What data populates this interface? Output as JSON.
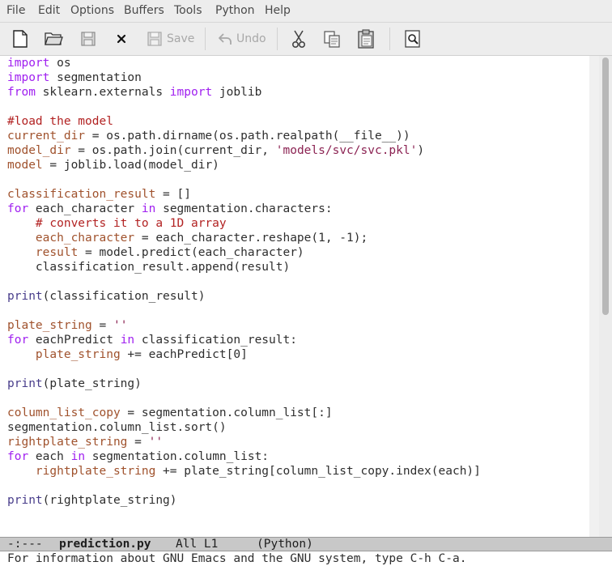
{
  "menu": [
    "File",
    "Edit",
    "Options",
    "Buffers",
    "Tools",
    "Python",
    "Help"
  ],
  "toolbar": {
    "save_label": "Save",
    "undo_label": "Undo"
  },
  "code": [
    [
      {
        "t": "import",
        "c": "kw"
      },
      {
        "t": " os"
      }
    ],
    [
      {
        "t": "import",
        "c": "kw"
      },
      {
        "t": " segmentation"
      }
    ],
    [
      {
        "t": "from",
        "c": "kw"
      },
      {
        "t": " sklearn.externals "
      },
      {
        "t": "import",
        "c": "kw"
      },
      {
        "t": " joblib"
      }
    ],
    [],
    [
      {
        "t": "#load the model",
        "c": "cm"
      }
    ],
    [
      {
        "t": "current_dir",
        "c": "var"
      },
      {
        "t": " = os.path.dirname(os.path.realpath(__file__))"
      }
    ],
    [
      {
        "t": "model_dir",
        "c": "var"
      },
      {
        "t": " = os.path.join(current_dir, "
      },
      {
        "t": "'models/svc/svc.pkl'",
        "c": "st"
      },
      {
        "t": ")"
      }
    ],
    [
      {
        "t": "model",
        "c": "var"
      },
      {
        "t": " = joblib.load(model_dir)"
      }
    ],
    [],
    [
      {
        "t": "classification_result",
        "c": "var"
      },
      {
        "t": " = []"
      }
    ],
    [
      {
        "t": "for",
        "c": "kw"
      },
      {
        "t": " each_character "
      },
      {
        "t": "in",
        "c": "kw"
      },
      {
        "t": " segmentation.characters:"
      }
    ],
    [
      {
        "t": "    "
      },
      {
        "t": "# converts it to a 1D array",
        "c": "cm"
      }
    ],
    [
      {
        "t": "    "
      },
      {
        "t": "each_character",
        "c": "var"
      },
      {
        "t": " = each_character.reshape(1, -1);"
      }
    ],
    [
      {
        "t": "    "
      },
      {
        "t": "result",
        "c": "var"
      },
      {
        "t": " = model.predict(each_character)"
      }
    ],
    [
      {
        "t": "    classification_result.append(result)"
      }
    ],
    [],
    [
      {
        "t": "print",
        "c": "bi"
      },
      {
        "t": "(classification_result)"
      }
    ],
    [],
    [
      {
        "t": "plate_string",
        "c": "var"
      },
      {
        "t": " = "
      },
      {
        "t": "''",
        "c": "st"
      }
    ],
    [
      {
        "t": "for",
        "c": "kw"
      },
      {
        "t": " eachPredict "
      },
      {
        "t": "in",
        "c": "kw"
      },
      {
        "t": " classification_result:"
      }
    ],
    [
      {
        "t": "    "
      },
      {
        "t": "plate_string",
        "c": "var"
      },
      {
        "t": " += eachPredict[0]"
      }
    ],
    [],
    [
      {
        "t": "print",
        "c": "bi"
      },
      {
        "t": "(plate_string)"
      }
    ],
    [],
    [
      {
        "t": "column_list_copy",
        "c": "var"
      },
      {
        "t": " = segmentation.column_list[:]"
      }
    ],
    [
      {
        "t": "segmentation.column_list.sort()"
      }
    ],
    [
      {
        "t": "rightplate_string",
        "c": "var"
      },
      {
        "t": " = "
      },
      {
        "t": "''",
        "c": "st"
      }
    ],
    [
      {
        "t": "for",
        "c": "kw"
      },
      {
        "t": " each "
      },
      {
        "t": "in",
        "c": "kw"
      },
      {
        "t": " segmentation.column_list:"
      }
    ],
    [
      {
        "t": "    "
      },
      {
        "t": "rightplate_string",
        "c": "var"
      },
      {
        "t": " += plate_string[column_list_copy.index(each)]"
      }
    ],
    [],
    [
      {
        "t": "print",
        "c": "bi"
      },
      {
        "t": "(rightplate_string)"
      }
    ]
  ],
  "modeline": {
    "status": "-:---",
    "buffer": "prediction.py",
    "position": "All L1",
    "mode": "(Python)"
  },
  "echo": "For information about GNU Emacs and the GNU system, type C-h C-a."
}
